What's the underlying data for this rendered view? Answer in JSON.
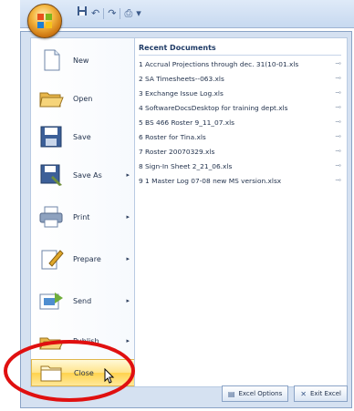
{
  "quick_access": {
    "save_icon": "save-icon",
    "undo_icon": "undo-icon",
    "redo_icon": "redo-icon",
    "print_icon": "print-icon",
    "customize_icon": "chevron-down-icon"
  },
  "menu": {
    "items": [
      {
        "label": "New",
        "icon": "new-document-icon",
        "has_arrow": false
      },
      {
        "label": "Open",
        "icon": "folder-open-icon",
        "has_arrow": false
      },
      {
        "label": "Save",
        "icon": "save-icon",
        "has_arrow": false
      },
      {
        "label": "Save As",
        "icon": "save-as-icon",
        "has_arrow": true
      },
      {
        "label": "Print",
        "icon": "printer-icon",
        "has_arrow": true
      },
      {
        "label": "Prepare",
        "icon": "prepare-icon",
        "has_arrow": true
      },
      {
        "label": "Send",
        "icon": "send-icon",
        "has_arrow": true
      },
      {
        "label": "Publish",
        "icon": "publish-icon",
        "has_arrow": true
      },
      {
        "label": "Close",
        "icon": "close-folder-icon",
        "has_arrow": false
      }
    ],
    "arrow": "▸"
  },
  "recent": {
    "title": "Recent Documents",
    "items": [
      "1 Accrual Projections through dec. 31(10-01.xls",
      "2 SA Timesheets--063.xls",
      "3 Exchange Issue Log.xls",
      "4 SoftwareDocsDesktop for training dept.xls",
      "5 BS 466 Roster 9_11_07.xls",
      "6 Roster for Tina.xls",
      "7 Roster 20070329.xls",
      "8 Sign-In Sheet 2_21_06.xls",
      "9 1 Master Log 07-08 new MS version.xlsx"
    ],
    "pin_glyph": "⊸"
  },
  "footer": {
    "options_label": "Excel Options",
    "exit_label": "Exit Excel"
  },
  "colors": {
    "annotation": "#e01010",
    "highlight": "#ffd34d"
  }
}
